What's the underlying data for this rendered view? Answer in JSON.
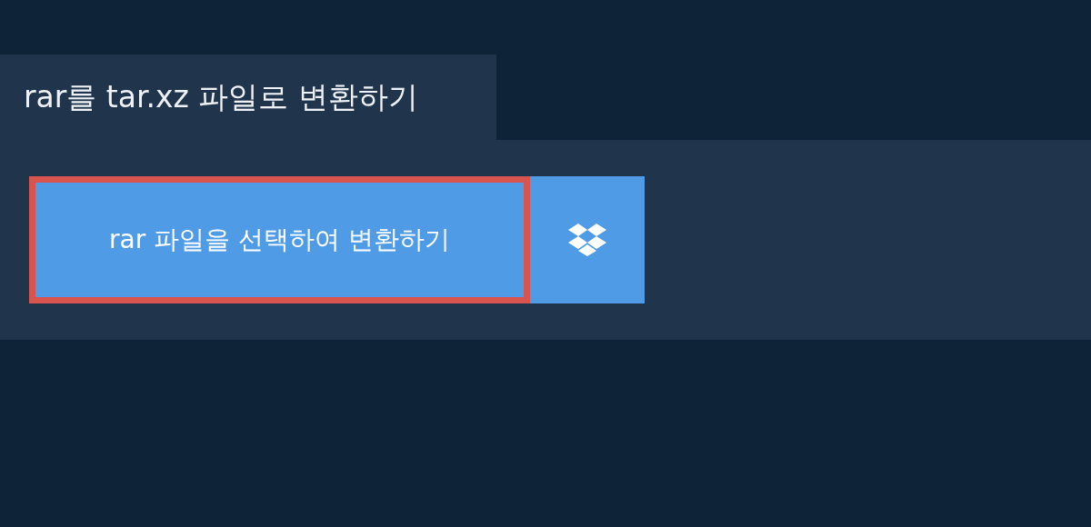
{
  "tab": {
    "title": "rar를 tar.xz 파일로 변환하기"
  },
  "upload": {
    "label": "rar 파일을 선택하여 변환하기",
    "focused": true
  }
}
